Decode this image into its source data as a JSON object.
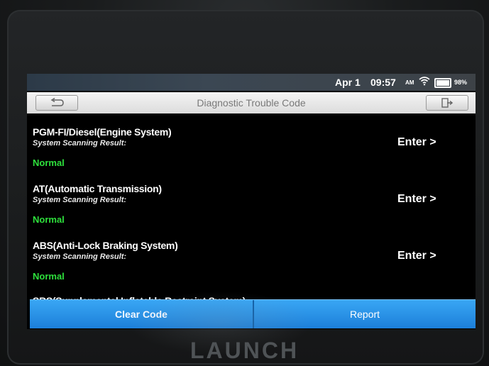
{
  "status_bar": {
    "date": "Apr 1",
    "time": "09:57",
    "ampm": "AM",
    "battery_percent": "98%",
    "battery_level": 0.98
  },
  "title_bar": {
    "title": "Diagnostic Trouble Code"
  },
  "systems": [
    {
      "name": "PGM-FI/Diesel(Engine System)",
      "scan_label": "System Scanning Result:",
      "result": "Normal",
      "enter_label": "Enter >"
    },
    {
      "name": "AT(Automatic Transmission)",
      "scan_label": "System Scanning Result:",
      "result": "Normal",
      "enter_label": "Enter >"
    },
    {
      "name": "ABS(Anti-Lock Braking System)",
      "scan_label": "System Scanning Result:",
      "result": "Normal",
      "enter_label": "Enter >"
    },
    {
      "name": "SRS(Supplemental Inflatable Restraint System)"
    }
  ],
  "bottom_bar": {
    "clear_label": "Clear Code",
    "report_label": "Report"
  },
  "device": {
    "brand": "LAUNCH"
  },
  "colors": {
    "normal_status": "#2ee03c",
    "action_bar": "#2a8fe6"
  }
}
